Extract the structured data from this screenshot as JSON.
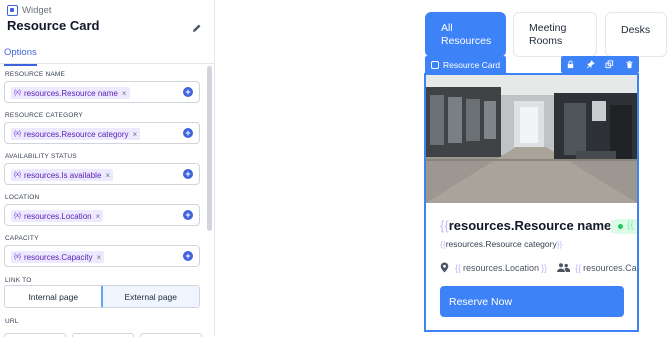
{
  "panel": {
    "widget_label": "Widget",
    "title": "Resource Card",
    "tab": "Options",
    "fields": [
      {
        "label": "RESOURCE NAME",
        "value": "resources.Resource name"
      },
      {
        "label": "RESOURCE CATEGORY",
        "value": "resources.Resource category"
      },
      {
        "label": "AVAILABILITY STATUS",
        "value": "resources.Is available"
      },
      {
        "label": "LOCATION",
        "value": "resources.Location"
      },
      {
        "label": "CAPACITY",
        "value": "resources.Capacity"
      }
    ],
    "chip_prefix": "{x}",
    "link_to_label": "LINK TO",
    "link_options": [
      "Internal page",
      "External page"
    ],
    "link_selected": "External page",
    "url_label": "URL"
  },
  "canvas": {
    "tabs": [
      {
        "label_line1": "All",
        "label_line2": "Resources",
        "active": true
      },
      {
        "label_line1": "Meeting",
        "label_line2": "Rooms",
        "active": false
      },
      {
        "label_line1": "Desks",
        "label_line2": "",
        "active": false
      }
    ],
    "card_label": "Resource Card",
    "card": {
      "title_binding": "resources.Resource name",
      "category_binding": "resources.Resource category",
      "location_binding": "resources.Location",
      "capacity_binding": "resources.Ca",
      "button_label": "Reserve Now"
    },
    "open_brace": "{{",
    "close_brace": "}}"
  },
  "colors": {
    "accent": "#3e82f7",
    "chip_bg": "#ede9fe",
    "chip_text": "#5b21b6"
  },
  "icons": {
    "widget": "widget-icon",
    "edit": "pencil-icon",
    "add": "plus-circle-icon",
    "toolbar": [
      "lock-icon",
      "pin-icon",
      "duplicate-icon",
      "trash-icon"
    ],
    "location": "map-pin-icon",
    "capacity": "users-icon"
  }
}
